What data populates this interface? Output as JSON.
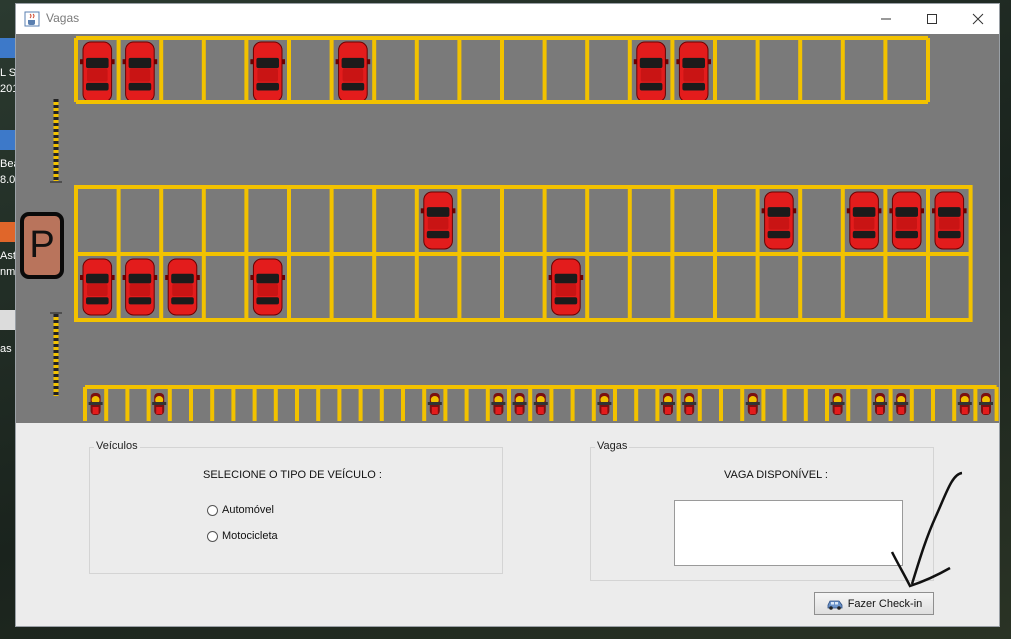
{
  "window": {
    "title": "Vagas",
    "app_icon": "java-coffee-icon"
  },
  "titlebar_controls": {
    "minimize_icon": "minimize-icon",
    "maximize_icon": "maximize-icon",
    "close_icon": "close-icon"
  },
  "desktop": {
    "labels": [
      "L S",
      "201",
      "Bea",
      "8.0",
      "Ast",
      "nm",
      "as"
    ]
  },
  "lot": {
    "sign_text": "P",
    "top_row": [
      "car",
      "car",
      "empty",
      "empty",
      "car",
      "empty",
      "car",
      "empty",
      "empty",
      "empty",
      "empty",
      "empty",
      "empty",
      "car",
      "car",
      "empty",
      "empty",
      "empty",
      "empty",
      "empty"
    ],
    "middle_upper_row": [
      "empty",
      "empty",
      "empty",
      "empty",
      "empty",
      "empty",
      "empty",
      "empty",
      "car",
      "empty",
      "empty",
      "empty",
      "empty",
      "empty",
      "empty",
      "empty",
      "car",
      "empty",
      "car",
      "car",
      "car"
    ],
    "middle_lower_row": [
      "car",
      "car",
      "car",
      "empty",
      "car",
      "empty",
      "empty",
      "empty",
      "empty",
      "empty",
      "empty",
      "car",
      "empty",
      "empty",
      "empty",
      "empty",
      "empty",
      "empty",
      "empty",
      "empty",
      "empty"
    ],
    "moto_row": [
      "moto",
      "empty",
      "empty",
      "moto",
      "empty",
      "empty",
      "empty",
      "empty",
      "empty",
      "empty",
      "empty",
      "empty",
      "empty",
      "empty",
      "empty",
      "empty",
      "moto",
      "empty",
      "empty",
      "moto",
      "moto",
      "moto",
      "empty",
      "empty",
      "moto",
      "empty",
      "empty",
      "moto",
      "moto",
      "empty",
      "empty",
      "moto",
      "empty",
      "empty",
      "empty",
      "moto",
      "empty",
      "moto",
      "moto",
      "empty",
      "empty",
      "moto",
      "moto"
    ]
  },
  "veiculos": {
    "group_title": "Veículos",
    "prompt": "SELECIONE O TIPO DE VEÍCULO :",
    "options": [
      {
        "label": "Automóvel"
      },
      {
        "label": "Motocicleta"
      }
    ]
  },
  "vagas": {
    "group_title": "Vagas",
    "prompt": "VAGA DISPONÍVEL :",
    "value": ""
  },
  "checkin_button": {
    "label": "Fazer Check-in",
    "icon": "car-icon"
  },
  "colors": {
    "lot_background": "#7a7a7a",
    "line_yellow": "#f2c200",
    "car_red": "#e31c1c",
    "sign_brown": "#b9745c"
  }
}
